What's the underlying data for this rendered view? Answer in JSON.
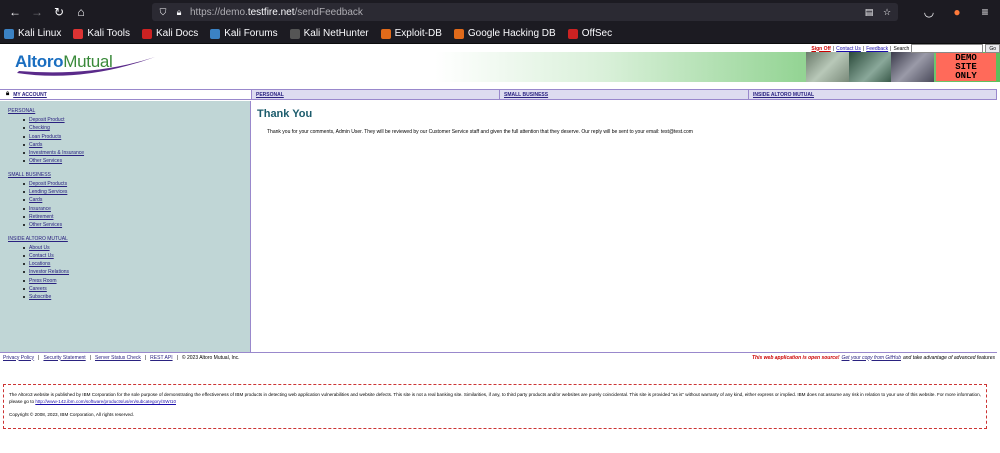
{
  "browser": {
    "url_prefix": "https://demo.",
    "url_domain": "testfire.net",
    "url_path": "/sendFeedback",
    "bookmarks": [
      {
        "label": "Kali Linux",
        "color": "#3b82c4"
      },
      {
        "label": "Kali Tools",
        "color": "#d33"
      },
      {
        "label": "Kali Docs",
        "color": "#c22"
      },
      {
        "label": "Kali Forums",
        "color": "#3b82c4"
      },
      {
        "label": "Kali NetHunter",
        "color": "#555"
      },
      {
        "label": "Exploit-DB",
        "color": "#e06a1a"
      },
      {
        "label": "Google Hacking DB",
        "color": "#e06a1a"
      },
      {
        "label": "OffSec",
        "color": "#c22"
      }
    ]
  },
  "header": {
    "logo_part1": "Altoro",
    "logo_part2": "Mutual",
    "sign_off": "Sign Off",
    "contact_us": "Contact Us",
    "feedback": "Feedback",
    "search_label": "Search",
    "search_value": "",
    "go_label": "Go",
    "demo_line1": "DEMO",
    "demo_line2": "SITE",
    "demo_line3": "ONLY"
  },
  "tabs": {
    "my_account": "MY ACCOUNT",
    "personal": "PERSONAL",
    "small_business": "SMALL BUSINESS",
    "inside": "INSIDE ALTORO MUTUAL"
  },
  "sidebar": {
    "personal": {
      "title": "PERSONAL",
      "items": [
        "Deposit Product",
        "Checking",
        "Loan Products",
        "Cards",
        "Investments & Insurance",
        "Other Services"
      ]
    },
    "small_business": {
      "title": "SMALL BUSINESS",
      "items": [
        "Deposit Products",
        "Lending Services",
        "Cards",
        "Insurance",
        "Retirement",
        "Other Services"
      ]
    },
    "inside": {
      "title": "INSIDE ALTORO MUTUAL",
      "items": [
        "About Us",
        "Contact Us",
        "Locations",
        "Investor Relations",
        "Press Room",
        "Careers",
        "Subscribe"
      ]
    }
  },
  "main": {
    "title": "Thank You",
    "message": "Thank you for your comments, Admin User. They will be reviewed by our Customer Service staff and given the full attention that they deserve. Our reply will be sent to your email: test@test.com"
  },
  "footer": {
    "privacy": "Privacy Policy",
    "security": "Security Statement",
    "server_status": "Server Status Check",
    "rest_api": "REST API",
    "copyright": "© 2023 Altoro Mutual, Inc.",
    "open_source": "This web application is open source!",
    "github_link": "Get your copy from GitHub",
    "advanced": "and take advantage of advanced features"
  },
  "disclaimer": {
    "text": "The Altoro3 website is published by IBM Corporation for the sole purpose of demonstrating the effectiveness of IBM products in detecting web application vulnerabilities and website defects. This site is not a real banking site. Similarities, if any, to third party products and/or websites are purely coincidental. This site is provided \"as is\" without warranty of any kind, either express or implied. IBM does not assume any risk in relation to your use of this website. For more information, please go to",
    "link": "http://www-142.ibm.com/software/products/us/en/subcategory/SWI10",
    "copyright": "Copyright © 2008, 2023, IBM Corporation, All rights reserved."
  }
}
